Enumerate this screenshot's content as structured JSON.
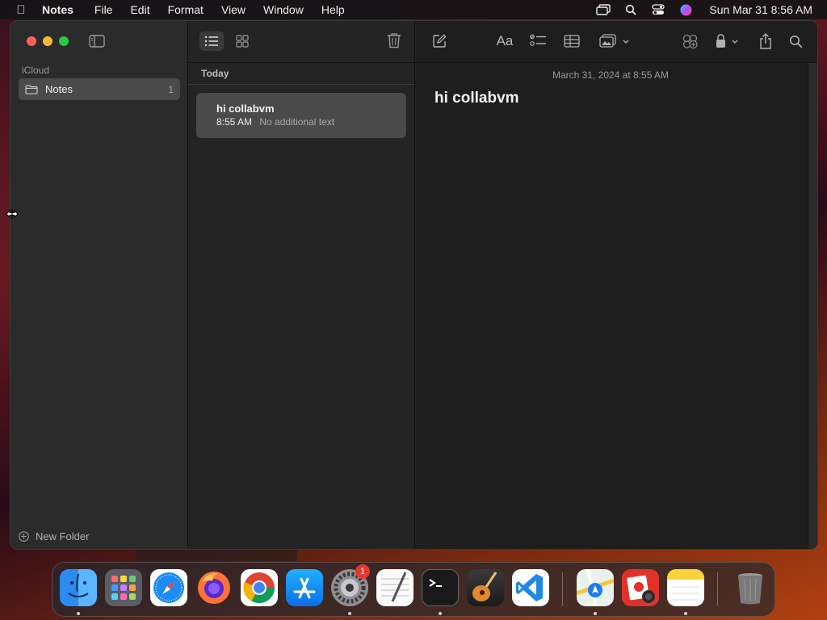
{
  "menubar": {
    "app_name": "Notes",
    "menus": [
      "File",
      "Edit",
      "Format",
      "View",
      "Window",
      "Help"
    ],
    "clock": "Sun Mar 31  8:56 AM"
  },
  "sidebar": {
    "account": "iCloud",
    "folders": [
      {
        "label": "Notes",
        "count": "1"
      }
    ],
    "new_folder_label": "New Folder"
  },
  "note_list": {
    "section": "Today",
    "notes": [
      {
        "title": "hi collabvm",
        "time": "8:55 AM",
        "preview": "No additional text"
      }
    ]
  },
  "editor": {
    "date": "March 31, 2024 at 8:55 AM",
    "title": "hi collabvm",
    "format_label": "Aa"
  },
  "dock": {
    "apps": [
      "Finder",
      "Launchpad",
      "Safari",
      "Firefox",
      "Chrome",
      "App Store",
      "System Settings",
      "TextEdit",
      "Terminal",
      "GarageBand",
      "Visual Studio Code",
      "Maps",
      "Photo Booth",
      "Notes",
      "Trash"
    ],
    "settings_badge": "1"
  },
  "colors": {
    "close": "#ff5f57",
    "minimize": "#febc2e",
    "maximize": "#28c840",
    "selection": "#4a4a4a"
  }
}
